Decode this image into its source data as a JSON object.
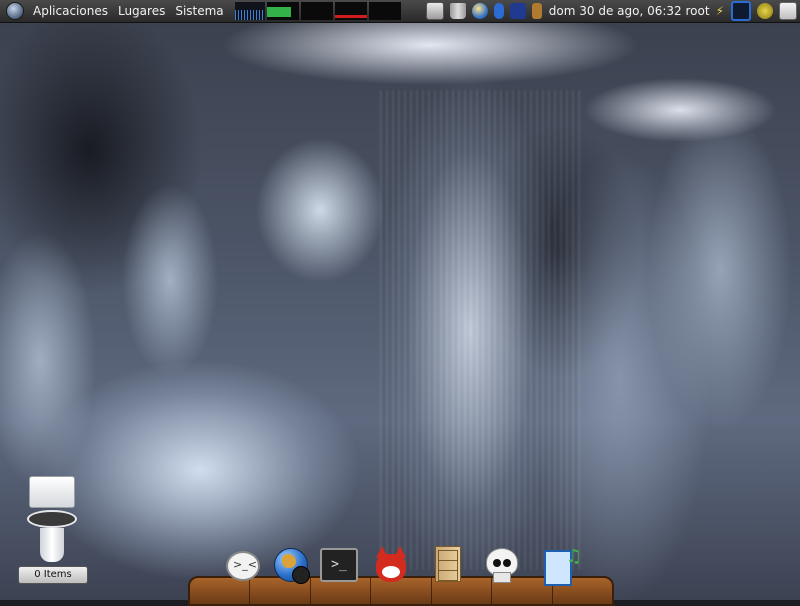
{
  "top_panel": {
    "menus": [
      "Aplicaciones",
      "Lugares",
      "Sistema"
    ],
    "clock": "dom 30 de ago, 06:32",
    "user": "root",
    "meters": [
      {
        "name": "cpu-meter",
        "color": "#33b24a",
        "level": 0.75
      },
      {
        "name": "mem-meter",
        "color": "#000000",
        "level": 0.0
      },
      {
        "name": "swap-meter",
        "color": "#d01c1c",
        "level": 0.2
      },
      {
        "name": "load-meter",
        "color": "#000000",
        "level": 0.0
      }
    ]
  },
  "desktop": {
    "trash_label": "0 Items"
  },
  "dock": {
    "icons": [
      "chat-icon",
      "web-browser-icon",
      "terminal-icon",
      "fox-icon",
      "file-cabinet-icon",
      "skull-icon",
      "media-door-icon"
    ]
  }
}
